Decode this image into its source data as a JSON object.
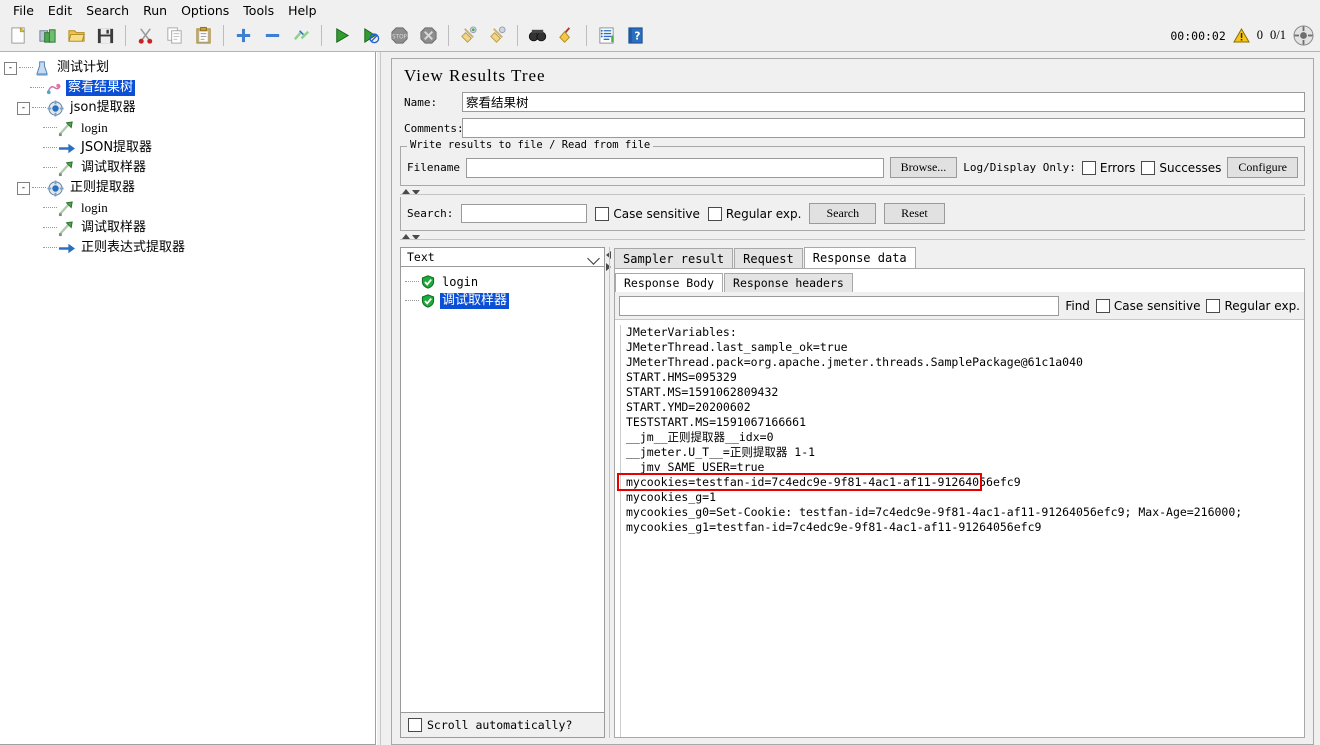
{
  "menubar": {
    "items": [
      "File",
      "Edit",
      "Search",
      "Run",
      "Options",
      "Tools",
      "Help"
    ]
  },
  "toolbar": {
    "buttons": [
      {
        "name": "new-icon",
        "glyph": "⬜"
      },
      {
        "name": "templates-icon",
        "glyph": "▤"
      },
      {
        "name": "open-icon",
        "glyph": "📂"
      },
      {
        "name": "save-icon",
        "glyph": "💾"
      },
      {
        "name": "cut-icon",
        "glyph": "✂"
      },
      {
        "name": "copy-icon",
        "glyph": "⧉"
      },
      {
        "name": "paste-icon",
        "glyph": "📋"
      },
      {
        "name": "expand-all-icon",
        "glyph": "＋"
      },
      {
        "name": "collapse-all-icon",
        "glyph": "－"
      },
      {
        "name": "toggle-icon",
        "glyph": "✎"
      },
      {
        "name": "start-icon",
        "glyph": "▶"
      },
      {
        "name": "start-no-pauses-icon",
        "glyph": "▶"
      },
      {
        "name": "stop-icon",
        "glyph": "STOP"
      },
      {
        "name": "shutdown-icon",
        "glyph": "✖"
      },
      {
        "name": "clear-icon",
        "glyph": "🧹"
      },
      {
        "name": "clear-all-icon",
        "glyph": "🧹"
      },
      {
        "name": "search-icon",
        "glyph": "🔭"
      },
      {
        "name": "search-reset-icon",
        "glyph": "🧹"
      },
      {
        "name": "function-helper-icon",
        "glyph": "☰"
      },
      {
        "name": "help-icon",
        "glyph": "?"
      }
    ],
    "timer": "00:00:02",
    "warning_count": "0",
    "thread_count": "0/1"
  },
  "tree": {
    "nodes": [
      {
        "label": "测试计划",
        "icon": "test-plan-icon",
        "depth": 0,
        "toggle": "-",
        "selected": false,
        "mono": false
      },
      {
        "label": "察看结果树",
        "icon": "view-results-tree-icon",
        "depth": 1,
        "toggle": "",
        "selected": true,
        "mono": false
      },
      {
        "label": "json提取器",
        "icon": "thread-group-icon",
        "depth": 1,
        "toggle": "-",
        "selected": false,
        "mono": false
      },
      {
        "label": "login",
        "icon": "http-sampler-icon",
        "depth": 2,
        "toggle": "",
        "selected": false,
        "mono": true
      },
      {
        "label": "JSON提取器",
        "icon": "post-processor-icon",
        "depth": 2,
        "toggle": "",
        "selected": false,
        "mono": false
      },
      {
        "label": "调试取样器",
        "icon": "http-sampler-icon",
        "depth": 2,
        "toggle": "",
        "selected": false,
        "mono": false
      },
      {
        "label": "正则提取器",
        "icon": "thread-group-icon",
        "depth": 1,
        "toggle": "-",
        "selected": false,
        "mono": false
      },
      {
        "label": "login",
        "icon": "http-sampler-icon",
        "depth": 2,
        "toggle": "",
        "selected": false,
        "mono": true
      },
      {
        "label": "调试取样器",
        "icon": "http-sampler-icon",
        "depth": 2,
        "toggle": "",
        "selected": false,
        "mono": false
      },
      {
        "label": "正则表达式提取器",
        "icon": "post-processor-icon",
        "depth": 2,
        "toggle": "",
        "selected": false,
        "mono": false
      }
    ]
  },
  "panel": {
    "title": "View Results Tree",
    "name_label": "Name:",
    "name_value": "察看结果树",
    "comments_label": "Comments:",
    "comments_value": ""
  },
  "file_group": {
    "title": "Write results to file / Read from file",
    "filename_label": "Filename",
    "filename_value": "",
    "browse_label": "Browse...",
    "logdisplay_label": "Log/Display Only:",
    "errors_label": "Errors",
    "errors_checked": false,
    "successes_label": "Successes",
    "successes_checked": false,
    "configure_label": "Configure"
  },
  "search_bar": {
    "label": "Search:",
    "value": "",
    "case_sensitive_label": "Case sensitive",
    "case_sensitive_checked": false,
    "regex_label": "Regular exp.",
    "regex_checked": false,
    "search_button": "Search",
    "reset_button": "Reset"
  },
  "results": {
    "render_selected": "Text",
    "samplers": [
      {
        "label": "login",
        "status": "ok",
        "selected": false,
        "mono": true
      },
      {
        "label": "调试取样器",
        "status": "ok",
        "selected": true,
        "mono": false
      }
    ],
    "scroll_auto_label": "Scroll automatically?",
    "scroll_auto_checked": false
  },
  "tabs": {
    "primary": [
      {
        "label": "Sampler result",
        "active": false
      },
      {
        "label": "Request",
        "active": false
      },
      {
        "label": "Response data",
        "active": true
      }
    ],
    "secondary": [
      {
        "label": "Response Body",
        "active": true
      },
      {
        "label": "Response headers",
        "active": false
      }
    ]
  },
  "find_bar": {
    "value": "",
    "find_label": "Find",
    "case_sensitive_label": "Case sensitive",
    "case_sensitive_checked": false,
    "regex_label": "Regular exp.",
    "regex_checked": false
  },
  "response_body": {
    "highlight_line_index": 10,
    "highlight_color": "#e60000",
    "lines": [
      "JMeterVariables:",
      "JMeterThread.last_sample_ok=true",
      "JMeterThread.pack=org.apache.jmeter.threads.SamplePackage@61c1a040",
      "START.HMS=095329",
      "START.MS=1591062809432",
      "START.YMD=20200602",
      "TESTSTART.MS=1591067166661",
      "__jm__正则提取器__idx=0",
      "__jmeter.U_T__=正则提取器 1-1",
      "  jmv SAME USER=true",
      "mycookies=testfan-id=7c4edc9e-9f81-4ac1-af11-91264056efc9",
      "mycookies_g=1",
      "mycookies_g0=Set-Cookie: testfan-id=7c4edc9e-9f81-4ac1-af11-91264056efc9; Max-Age=216000;",
      "mycookies_g1=testfan-id=7c4edc9e-9f81-4ac1-af11-91264056efc9"
    ]
  },
  "colors": {
    "selection_blue": "#0a4fd6",
    "panel_bg": "#f0f0f0",
    "highlight_red": "#e60000",
    "ok_green": "#1faa3c"
  }
}
